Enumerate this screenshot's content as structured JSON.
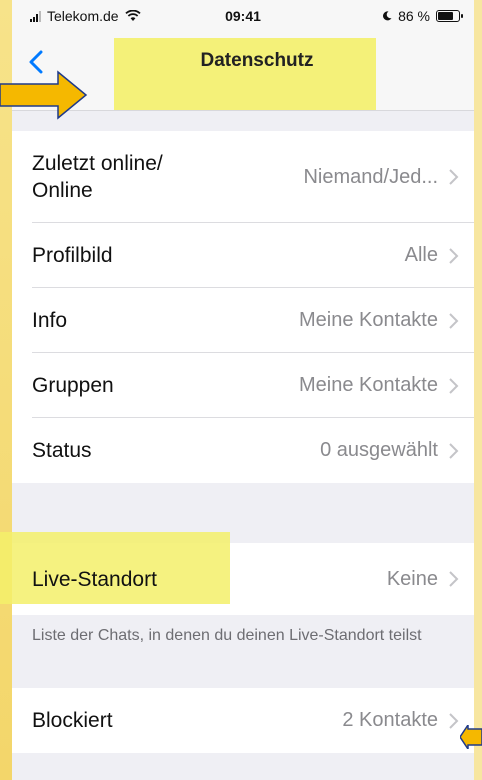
{
  "status_bar": {
    "carrier": "Telekom.de",
    "time": "09:41",
    "battery": "86 %",
    "battery_level": 0.86
  },
  "nav": {
    "back_icon": "chevron-left-icon",
    "title": "Datenschutz"
  },
  "section1": [
    {
      "label": "Zuletzt online/\nOnline",
      "value": "Niemand/Jed..."
    },
    {
      "label": "Profilbild",
      "value": "Alle"
    },
    {
      "label": "Info",
      "value": "Meine Kontakte"
    },
    {
      "label": "Gruppen",
      "value": "Meine Kontakte"
    },
    {
      "label": "Status",
      "value": "0 ausgewählt"
    }
  ],
  "section2": {
    "label": "Live-Standort",
    "value": "Keine",
    "caption": "Liste der Chats, in denen du deinen Live-Standort teilst"
  },
  "section3": {
    "label": "Blockiert",
    "value": "2 Kontakte"
  },
  "colors": {
    "highlight": "#f3f06a",
    "arrow": "#f5b800",
    "accent": "#007aff"
  }
}
